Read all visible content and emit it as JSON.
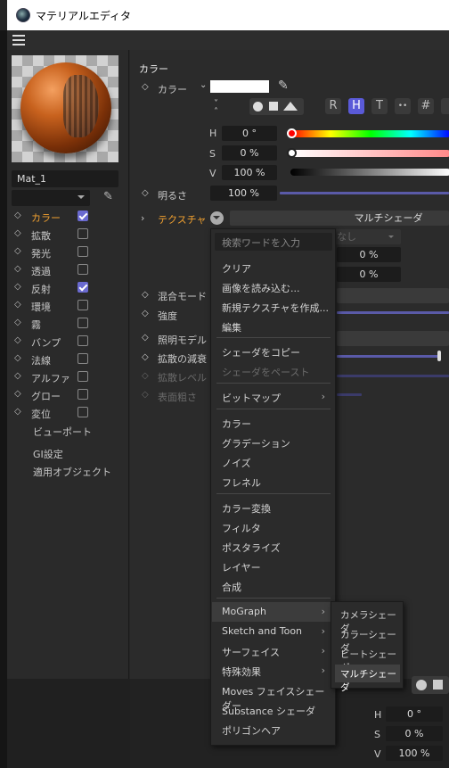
{
  "window": {
    "title": "マテリアルエディタ"
  },
  "left": {
    "material_name": "Mat_1",
    "channels": [
      {
        "label": "カラー",
        "checked": true,
        "active": true
      },
      {
        "label": "拡散",
        "checked": false
      },
      {
        "label": "発光",
        "checked": false
      },
      {
        "label": "透過",
        "checked": false
      },
      {
        "label": "反射",
        "checked": true
      },
      {
        "label": "環境",
        "checked": false
      },
      {
        "label": "霧",
        "checked": false
      },
      {
        "label": "バンプ",
        "checked": false
      },
      {
        "label": "法線",
        "checked": false
      },
      {
        "label": "アルファ",
        "checked": false
      },
      {
        "label": "グロー",
        "checked": false
      },
      {
        "label": "変位",
        "checked": false
      }
    ],
    "extra": [
      "ビューポート",
      "GI設定",
      "適用オブジェクト"
    ]
  },
  "right": {
    "section_title": "カラー",
    "color_label": "カラー",
    "mode_buttons": [
      "R",
      "H",
      "T",
      "••",
      "#"
    ],
    "h_label": "H",
    "h_value": "0 °",
    "s_label": "S",
    "s_value": "0 %",
    "v_label": "V",
    "v_value": "100 %",
    "brightness_label": "明るさ",
    "brightness_value": "100 %",
    "texture_label": "テクスチャ",
    "texture_value": "マルチシェーダ",
    "none_label": "なし",
    "val1": "0 %",
    "val2": "0 %",
    "labels": [
      "混合モード",
      "強度",
      "照明モデル",
      "拡散の減衰",
      "拡散レベル",
      "表面粗さ"
    ]
  },
  "dropdown": {
    "search_placeholder": "検索ワードを入力",
    "items": [
      "クリア",
      "画像を読み込む...",
      "新規テクスチャを作成...",
      "編集",
      "シェーダをコピー",
      "シェーダをペースト",
      "ビットマップ",
      "カラー",
      "グラデーション",
      "ノイズ",
      "フレネル",
      "カラー変換",
      "フィルタ",
      "ポスタライズ",
      "レイヤー",
      "合成",
      "MoGraph",
      "Sketch and Toon",
      "サーフェイス",
      "特殊効果",
      "Moves フェイスシェーダー",
      "Substance シェーダ",
      "ポリゴンヘア"
    ]
  },
  "submenu": {
    "items": [
      "カメラシェーダ",
      "カラーシェーダ",
      "ビートシェーダ",
      "マルチシェーダ"
    ]
  },
  "bottom": {
    "h_label": "H",
    "h_value": "0 °",
    "s_label": "S",
    "s_value": "0 %",
    "v_label": "V",
    "v_value": "100 %"
  }
}
